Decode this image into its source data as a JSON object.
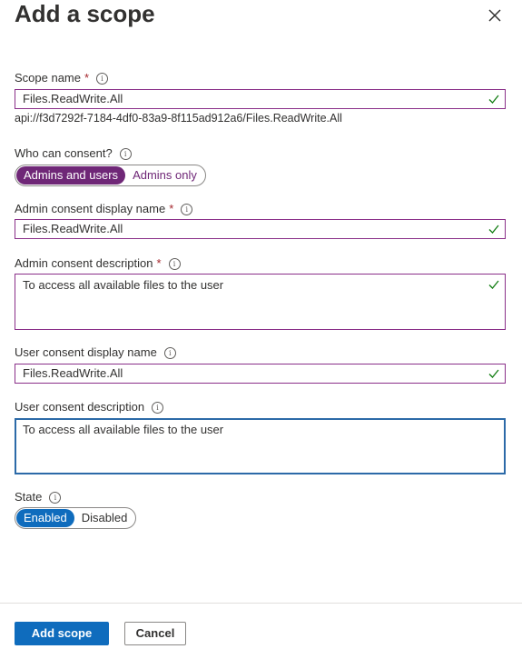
{
  "panel": {
    "title": "Add a scope",
    "close_label": "Close"
  },
  "fields": {
    "scope_name": {
      "label": "Scope name",
      "required_mark": "*",
      "value": "Files.ReadWrite.All",
      "uri": "api://f3d7292f-7184-4df0-83a9-8f115ad912a6/Files.ReadWrite.All"
    },
    "who_can_consent": {
      "label": "Who can consent?",
      "options": [
        "Admins and users",
        "Admins only"
      ],
      "selected": "Admins and users"
    },
    "admin_display_name": {
      "label": "Admin consent display name",
      "required_mark": "*",
      "value": "Files.ReadWrite.All"
    },
    "admin_description": {
      "label": "Admin consent description",
      "required_mark": "*",
      "value": "To access all available files to the user"
    },
    "user_display_name": {
      "label": "User consent display name",
      "value": "Files.ReadWrite.All"
    },
    "user_description": {
      "label": "User consent description",
      "value": "To access all available files to the user"
    },
    "state": {
      "label": "State",
      "options": [
        "Enabled",
        "Disabled"
      ],
      "selected": "Enabled"
    }
  },
  "footer": {
    "add_label": "Add scope",
    "cancel_label": "Cancel"
  },
  "icons": {
    "info": "info-icon",
    "check": "checkmark-icon",
    "close": "close-icon"
  },
  "colors": {
    "input_border": "#8a2f89",
    "focus_border": "#2c6aa8",
    "consent_selected": "#6f2777",
    "state_selected": "#0f6cbd",
    "primary_button": "#0f6cbd",
    "required": "#a4262c",
    "valid_check": "#107c10"
  }
}
